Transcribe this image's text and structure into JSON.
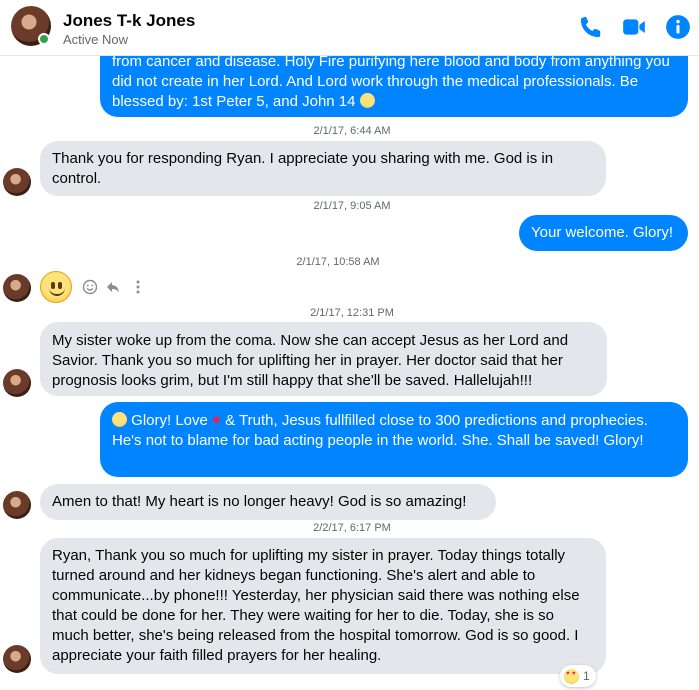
{
  "header": {
    "name": "Jones T-k Jones",
    "status": "Active Now"
  },
  "messages": {
    "m1": "from cancer and disease. Holy Fire purifying here blood and body from anything you did not create in her Lord. And Lord work through the medical professionals. Be blessed by: 1st Peter 5, and John 14",
    "t1": "2/1/17, 6:44 AM",
    "m2": "Thank you for responding Ryan.  I appreciate you sharing with me.  God is in control.",
    "t2": "2/1/17, 9:05 AM",
    "m3": "Your welcome. Glory!",
    "t3": "2/1/17, 10:58 AM",
    "t4": "2/1/17, 12:31 PM",
    "m4": "My sister woke up from the coma.  Now she can accept Jesus as her Lord and Savior.  Thank you so much for uplifting her in prayer.  Her doctor said that her prognosis looks grim, but I'm still happy that she'll be saved.  Hallelujah!!!",
    "m5a": "Glory! Love",
    "m5b": "& Truth, Jesus fullfilled close to 300 predictions and prophecies. He's not to blame for bad acting people in the world. She. Shall be saved! Glory!",
    "m6": "Amen to that!  My heart is no longer heavy!  God is so amazing!",
    "t5": "2/2/17, 6:17 PM",
    "m7": "Ryan, Thank you so much for uplifting my sister in prayer.  Today things totally turned around and her kidneys began functioning.  She's alert and able to communicate...by phone!!!  Yesterday, her physician said there was nothing else that could be done for her.  They were waiting for her to die.  Today, she is so much better, she's being released from the hospital tomorrow.  God is so good.  I appreciate your faith filled prayers for her healing.",
    "reaction_count": "1"
  },
  "colors": {
    "accent": "#0084ff",
    "incoming_bubble": "#e4e6eb",
    "active": "#31a24c"
  },
  "icons": [
    "phone-icon",
    "video-icon",
    "info-icon",
    "smiley-react-icon",
    "reply-icon",
    "more-icon",
    "heart-emoji",
    "smile-emoji",
    "heart-eyes-reaction"
  ]
}
